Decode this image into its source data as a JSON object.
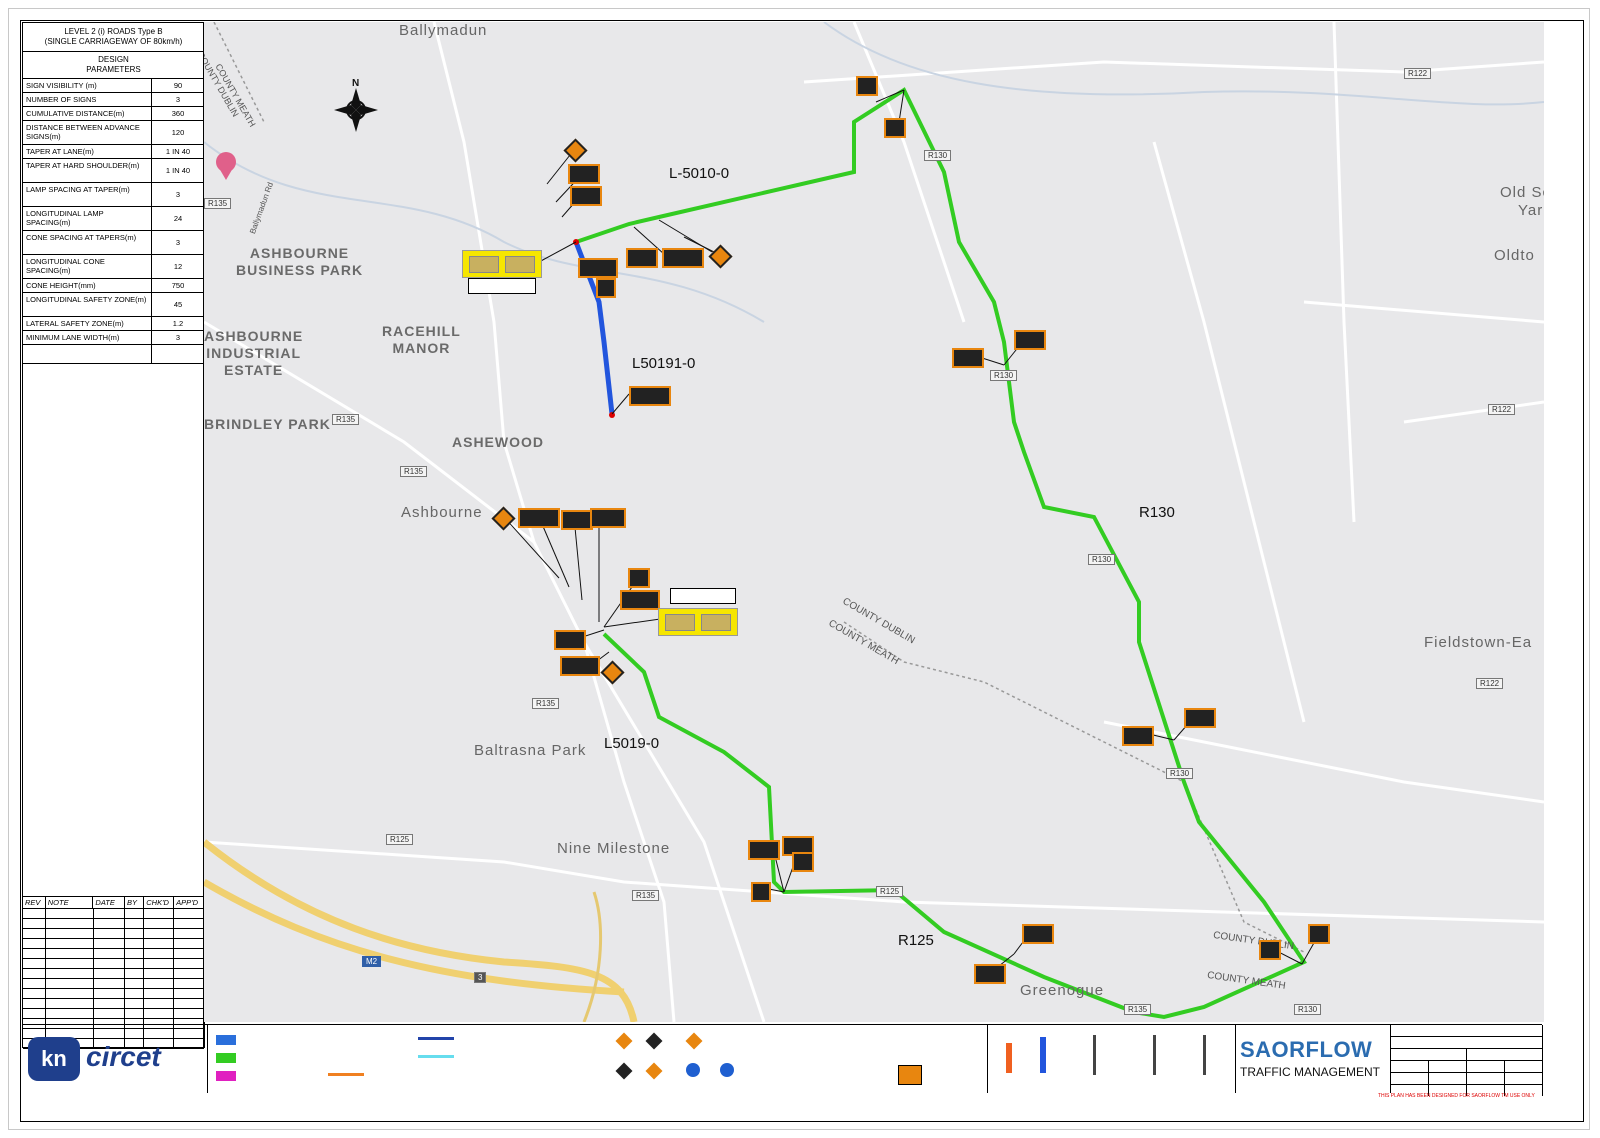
{
  "table": {
    "title": "LEVEL 2 (i) ROADS Type B\n(SINGLE CARRIAGEWAY OF 80km/h)",
    "subtitle": "DESIGN\nPARAMETERS",
    "rows": [
      {
        "k": "SIGN VISIBILITY (m)",
        "v": "90"
      },
      {
        "k": "NUMBER OF SIGNS",
        "v": "3"
      },
      {
        "k": "CUMULATIVE DISTANCE(m)",
        "v": "360"
      },
      {
        "k": "DISTANCE BETWEEN ADVANCE SIGNS(m)",
        "v": "120"
      },
      {
        "k": "TAPER AT LANE(m)",
        "v": "1 IN 40"
      },
      {
        "k": "TAPER AT HARD SHOULDER(m)",
        "v": "1 IN 40"
      },
      {
        "k": "LAMP SPACING AT TAPER(m)",
        "v": "3"
      },
      {
        "k": "LONGITUDINAL LAMP SPACING(m)",
        "v": "24"
      },
      {
        "k": "CONE SPACING AT TAPERS(m)",
        "v": "3"
      },
      {
        "k": "LONGITUDINAL CONE SPACING(m)",
        "v": "12"
      },
      {
        "k": "CONE HEIGHT(mm)",
        "v": "750"
      },
      {
        "k": "LONGITUDINAL SAFETY ZONE(m)",
        "v": "45"
      },
      {
        "k": "LATERAL SAFETY ZONE(m)",
        "v": "1.2"
      },
      {
        "k": "MINIMUM LANE WIDTH(m)",
        "v": "3"
      },
      {
        "k": "",
        "v": ""
      }
    ],
    "rev_headers": [
      "REV",
      "NOTE",
      "DATE",
      "BY",
      "CHK'D",
      "APP'D"
    ]
  },
  "map": {
    "places": {
      "ballymadun": "Ballymadun",
      "ashbourne_bp": "ASHBOURNE\nBUSINESS PARK",
      "ashbourne_ie": "ASHBOURNE\nINDUSTRIAL\nESTATE",
      "racehill": "RACEHILL\nMANOR",
      "brindley": "BRINDLEY PARK",
      "ashewood": "ASHEWOOD",
      "ashbourne": "Ashbourne",
      "baltrasna": "Baltrasna Park",
      "nine_milestone": "Nine Milestone",
      "greenogue": "Greenogue",
      "old_sc": "Old Sc",
      "yar": "Yar",
      "oldto": "Oldto",
      "fieldstown": "Fieldstown-Ea",
      "county_dublin_1": "COUNTY DUBLIN",
      "county_meath_1": "COUNTY MEATH",
      "county_dublin_2": "COUNTY DUBLIN",
      "county_meath_2": "COUNTY MEATH",
      "county_dublin_3": "COUNTY DUBLIN",
      "county_meath_3": "COUNTY MEATH",
      "ballymadun_rd": "Ballymadun Rd"
    },
    "routes": {
      "l5010": "L-5010-0",
      "l50191": "L50191-0",
      "l5019": "L5019-0",
      "r130": "R130",
      "r125": "R125"
    },
    "shields": [
      "R122",
      "R130",
      "R135",
      "R135",
      "R135",
      "R130",
      "R122",
      "R130",
      "R122",
      "R130",
      "R135",
      "R125",
      "R135",
      "R125",
      "R130",
      "M2",
      "3",
      "R135"
    ],
    "compass": "N",
    "route_colors": {
      "diversion": "#33cc22",
      "closure": "#2255dd"
    }
  },
  "footer": {
    "logo_kn": "kn",
    "logo_text": "circet",
    "brand_main": "SAORFLOW",
    "brand_sub": "TRAFFIC MANAGEMENT",
    "warning": "THIS PLAN HAS BEEN DESIGNED FOR SAORFLOW TM USE ONLY"
  }
}
